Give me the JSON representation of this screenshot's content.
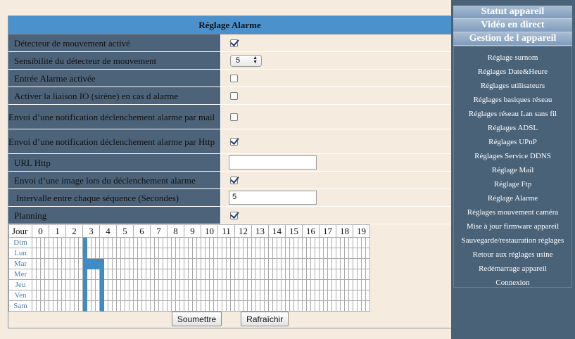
{
  "panel": {
    "title": "Réglage Alarme"
  },
  "fields": [
    {
      "label": "Détecteur de mouvement activé",
      "type": "checkbox",
      "checked": true
    },
    {
      "label": "Sensibilité du détecteur de mouvement",
      "type": "select",
      "value": "5"
    },
    {
      "label": "Entrée Alarme activée",
      "type": "checkbox",
      "checked": false
    },
    {
      "label": "Activer la liaison IO (sirène) en cas d alarme",
      "type": "checkbox",
      "checked": false
    },
    {
      "label": "Envoi d’une notification déclenchement alarme par mail",
      "type": "checkbox",
      "checked": false
    },
    {
      "label": "Envoi d’une notification déclenchement alarme par Http",
      "type": "checkbox",
      "checked": true
    },
    {
      "label": "URL Http",
      "type": "text",
      "value": ""
    },
    {
      "label": "Envoi d’une image lors du déclenchement alarme",
      "type": "checkbox",
      "checked": true
    },
    {
      "label": "Intervalle entre chaque séquence (Secondes)",
      "type": "text",
      "value": "5"
    },
    {
      "label": "Planning",
      "type": "checkbox",
      "checked": true
    }
  ],
  "schedule": {
    "day_header": "Jour",
    "hours": [
      "0",
      "1",
      "2",
      "3",
      "4",
      "5",
      "6",
      "7",
      "8",
      "9",
      "10",
      "11",
      "12",
      "13",
      "14",
      "15",
      "16",
      "17",
      "18",
      "19"
    ],
    "days": [
      "Dim",
      "Lun",
      "Mar",
      "Mer",
      "Jeu",
      "Ven",
      "Sam"
    ],
    "active_slots": {
      "Dim": [
        [
          12,
          13
        ]
      ],
      "Lun": [
        [
          12,
          13
        ]
      ],
      "Mar": [
        [
          12,
          17
        ]
      ],
      "Mer": [
        [
          12,
          13
        ],
        [
          16,
          17
        ]
      ],
      "Jeu": [
        [
          12,
          13
        ],
        [
          16,
          17
        ]
      ],
      "Ven": [
        [
          12,
          13
        ],
        [
          16,
          17
        ]
      ],
      "Sam": [
        [
          12,
          13
        ],
        [
          16,
          17
        ]
      ]
    },
    "active_color": "#3f8cc5"
  },
  "buttons": {
    "submit": "Soumettre",
    "refresh": "Rafraîchir"
  },
  "sidebar": {
    "heads": [
      "Statut appareil",
      "Vidéo en direct",
      "Gestion de l appareil"
    ],
    "items": [
      "Réglage surnom",
      "Réglages Date&Heure",
      "Réglages utilisateurs",
      "Réglages basiques réseau",
      "Réglages réseau Lan sans fil",
      "Réglages ADSL",
      "Réglages UPnP",
      "Réglages Service DDNS",
      "Réglage Mail",
      "Réglage Ftp",
      "Réglage Alarme",
      "Réglages mouvement caméra",
      "Mise à jour firmware appareil",
      "Sauvegarde/restauration réglages",
      "Retour aux réglages usine",
      "Redémarrage appareil",
      "Connexion"
    ]
  },
  "colors": {
    "label_bg": "#4d6379",
    "title_bg": "#4b92cd",
    "content_bg": "#f5ecdf"
  }
}
